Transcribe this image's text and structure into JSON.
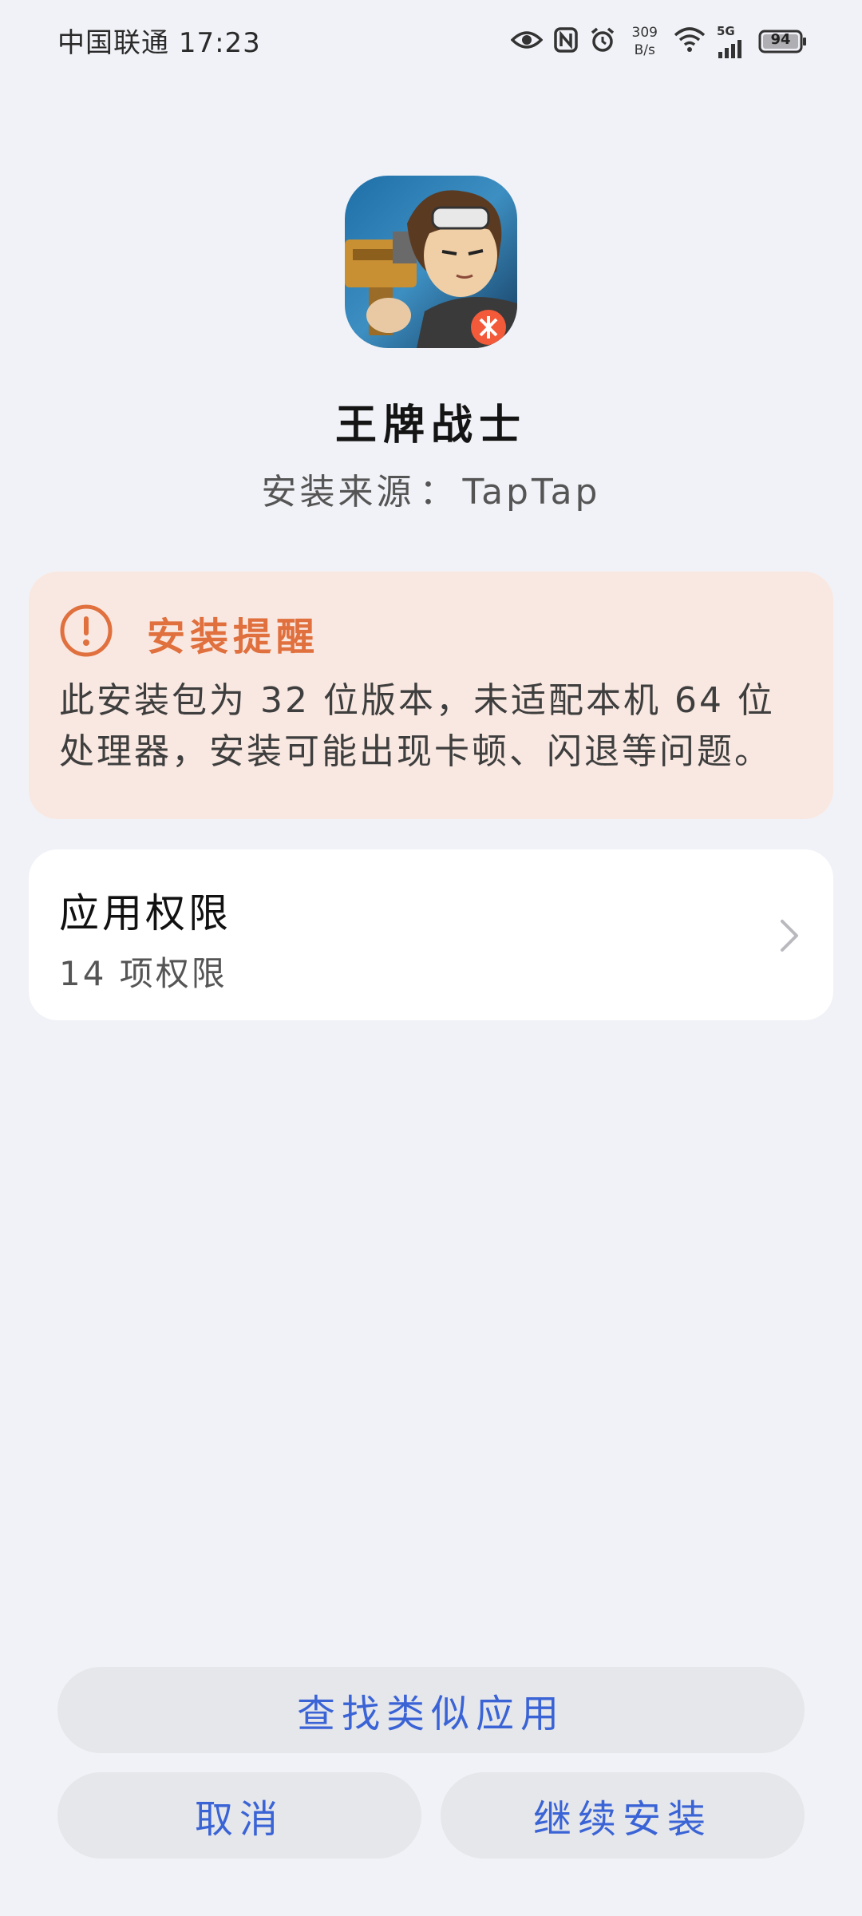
{
  "status_bar": {
    "carrier": "中国联通",
    "time": "17:23",
    "net_speed_value": "309",
    "net_speed_unit": "B/s",
    "network_label": "5G",
    "battery": "94",
    "icons": [
      "eye-icon",
      "nfc-icon",
      "alarm-icon",
      "wifi-icon",
      "signal-icon",
      "battery-icon"
    ]
  },
  "app": {
    "name": "王牌战士",
    "source_label": "安装来源",
    "source_sep": "：",
    "source_value": "TapTap"
  },
  "warning": {
    "title": "安装提醒",
    "body": "此安装包为 32 位版本，未适配本机 64 位处理器，安装可能出现卡顿、闪退等问题。",
    "color": "#e0703e",
    "background": "#f9e8e1"
  },
  "permissions": {
    "title": "应用权限",
    "count_text": "14 项权限"
  },
  "buttons": {
    "find_similar": "查找类似应用",
    "cancel": "取消",
    "continue_install": "继续安装",
    "accent": "#3a63d6"
  }
}
